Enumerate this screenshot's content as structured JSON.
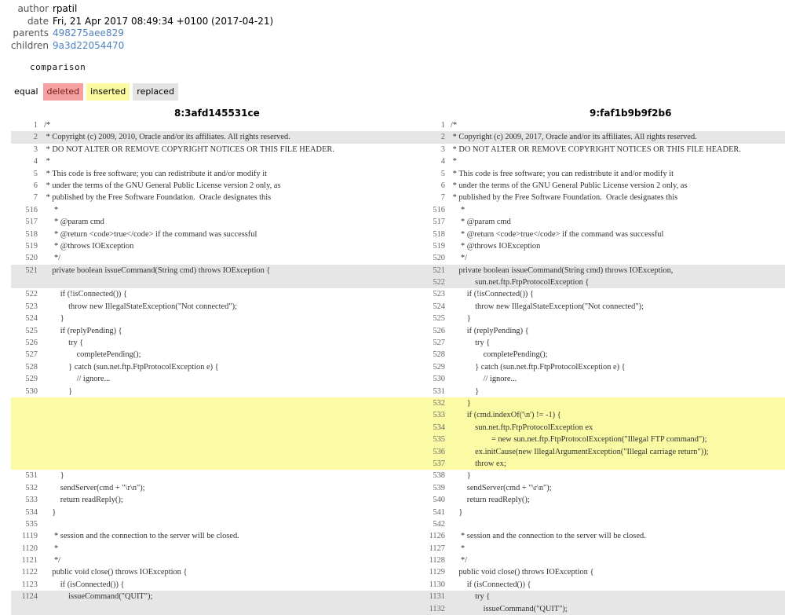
{
  "commit": {
    "author_label": "author",
    "author": "rpatil",
    "date_label": "date",
    "date": "Fri, 21 Apr 2017 08:49:34 +0100 (2017-04-21)",
    "parents_label": "parents",
    "parents": "498275aee829",
    "children_label": "children",
    "children": "9a3d22054470"
  },
  "comparison_title": "comparison",
  "legend": {
    "equal": "equal",
    "deleted": "deleted",
    "inserted": "inserted",
    "replaced": "replaced"
  },
  "left_rev": "8:3afd145531ce",
  "right_rev": "9:faf1b9b9f2b6",
  "rows": [
    {
      "type": "equal",
      "ln": "1",
      "lc": "/*",
      "rn": "1",
      "rc": "/*"
    },
    {
      "type": "replaced",
      "ln": "2",
      "lc": " * Copyright (c) 2009, 2010, Oracle and/or its affiliates. All rights reserved.",
      "rn": "2",
      "rc": " * Copyright (c) 2009, 2017, Oracle and/or its affiliates. All rights reserved."
    },
    {
      "type": "equal",
      "ln": "3",
      "lc": " * DO NOT ALTER OR REMOVE COPYRIGHT NOTICES OR THIS FILE HEADER.",
      "rn": "3",
      "rc": " * DO NOT ALTER OR REMOVE COPYRIGHT NOTICES OR THIS FILE HEADER."
    },
    {
      "type": "equal",
      "ln": "4",
      "lc": " *",
      "rn": "4",
      "rc": " *"
    },
    {
      "type": "equal",
      "ln": "5",
      "lc": " * This code is free software; you can redistribute it and/or modify it",
      "rn": "5",
      "rc": " * This code is free software; you can redistribute it and/or modify it"
    },
    {
      "type": "equal",
      "ln": "6",
      "lc": " * under the terms of the GNU General Public License version 2 only, as",
      "rn": "6",
      "rc": " * under the terms of the GNU General Public License version 2 only, as"
    },
    {
      "type": "equal",
      "ln": "7",
      "lc": " * published by the Free Software Foundation.  Oracle designates this",
      "rn": "7",
      "rc": " * published by the Free Software Foundation.  Oracle designates this"
    },
    {
      "type": "equal",
      "ln": "516",
      "lc": "     *",
      "rn": "516",
      "rc": "     *"
    },
    {
      "type": "equal",
      "ln": "517",
      "lc": "     * @param cmd",
      "rn": "517",
      "rc": "     * @param cmd"
    },
    {
      "type": "equal",
      "ln": "518",
      "lc": "     * @return <code>true</code> if the command was successful",
      "rn": "518",
      "rc": "     * @return <code>true</code> if the command was successful"
    },
    {
      "type": "equal",
      "ln": "519",
      "lc": "     * @throws IOException",
      "rn": "519",
      "rc": "     * @throws IOException"
    },
    {
      "type": "equal",
      "ln": "520",
      "lc": "     */",
      "rn": "520",
      "rc": "     */"
    },
    {
      "type": "replaced",
      "ln": "521",
      "lc": "    private boolean issueCommand(String cmd) throws IOException {",
      "rn": "521",
      "rc": "    private boolean issueCommand(String cmd) throws IOException,"
    },
    {
      "type": "replaced",
      "ln": "",
      "lc": "",
      "rn": "522",
      "rc": "            sun.net.ftp.FtpProtocolException {"
    },
    {
      "type": "equal",
      "ln": "522",
      "lc": "        if (!isConnected()) {",
      "rn": "523",
      "rc": "        if (!isConnected()) {"
    },
    {
      "type": "equal",
      "ln": "523",
      "lc": "            throw new IllegalStateException(\"Not connected\");",
      "rn": "524",
      "rc": "            throw new IllegalStateException(\"Not connected\");"
    },
    {
      "type": "equal",
      "ln": "524",
      "lc": "        }",
      "rn": "525",
      "rc": "        }"
    },
    {
      "type": "equal",
      "ln": "525",
      "lc": "        if (replyPending) {",
      "rn": "526",
      "rc": "        if (replyPending) {"
    },
    {
      "type": "equal",
      "ln": "526",
      "lc": "            try {",
      "rn": "527",
      "rc": "            try {"
    },
    {
      "type": "equal",
      "ln": "527",
      "lc": "                completePending();",
      "rn": "528",
      "rc": "                completePending();"
    },
    {
      "type": "equal",
      "ln": "528",
      "lc": "            } catch (sun.net.ftp.FtpProtocolException e) {",
      "rn": "529",
      "rc": "            } catch (sun.net.ftp.FtpProtocolException e) {"
    },
    {
      "type": "equal",
      "ln": "529",
      "lc": "                // ignore...",
      "rn": "530",
      "rc": "                // ignore..."
    },
    {
      "type": "equal",
      "ln": "530",
      "lc": "            }",
      "rn": "531",
      "rc": "            }"
    },
    {
      "type": "inserted",
      "ln": "",
      "lc": "",
      "rn": "532",
      "rc": "        }"
    },
    {
      "type": "inserted",
      "ln": "",
      "lc": "",
      "rn": "533",
      "rc": "        if (cmd.indexOf('\\n') != -1) {"
    },
    {
      "type": "inserted",
      "ln": "",
      "lc": "",
      "rn": "534",
      "rc": "            sun.net.ftp.FtpProtocolException ex"
    },
    {
      "type": "inserted",
      "ln": "",
      "lc": "",
      "rn": "535",
      "rc": "                    = new sun.net.ftp.FtpProtocolException(\"Illegal FTP command\");"
    },
    {
      "type": "inserted",
      "ln": "",
      "lc": "",
      "rn": "536",
      "rc": "            ex.initCause(new IllegalArgumentException(\"Illegal carriage return\"));"
    },
    {
      "type": "inserted",
      "ln": "",
      "lc": "",
      "rn": "537",
      "rc": "            throw ex;"
    },
    {
      "type": "equal",
      "ln": "531",
      "lc": "        }",
      "rn": "538",
      "rc": "        }"
    },
    {
      "type": "equal",
      "ln": "532",
      "lc": "        sendServer(cmd + \"\\r\\n\");",
      "rn": "539",
      "rc": "        sendServer(cmd + \"\\r\\n\");"
    },
    {
      "type": "equal",
      "ln": "533",
      "lc": "        return readReply();",
      "rn": "540",
      "rc": "        return readReply();"
    },
    {
      "type": "equal",
      "ln": "534",
      "lc": "    }",
      "rn": "541",
      "rc": "    }"
    },
    {
      "type": "equal",
      "ln": "535",
      "lc": "",
      "rn": "542",
      "rc": ""
    },
    {
      "type": "equal",
      "ln": "1119",
      "lc": "     * session and the connection to the server will be closed.",
      "rn": "1126",
      "rc": "     * session and the connection to the server will be closed."
    },
    {
      "type": "equal",
      "ln": "1120",
      "lc": "     *",
      "rn": "1127",
      "rc": "     *"
    },
    {
      "type": "equal",
      "ln": "1121",
      "lc": "     */",
      "rn": "1128",
      "rc": "     */"
    },
    {
      "type": "equal",
      "ln": "1122",
      "lc": "    public void close() throws IOException {",
      "rn": "1129",
      "rc": "    public void close() throws IOException {"
    },
    {
      "type": "equal",
      "ln": "1123",
      "lc": "        if (isConnected()) {",
      "rn": "1130",
      "rc": "        if (isConnected()) {"
    },
    {
      "type": "replaced",
      "ln": "1124",
      "lc": "            issueCommand(\"QUIT\");",
      "rn": "1131",
      "rc": "            try {"
    },
    {
      "type": "replaced",
      "ln": "",
      "lc": "",
      "rn": "1132",
      "rc": "                issueCommand(\"QUIT\");"
    }
  ]
}
